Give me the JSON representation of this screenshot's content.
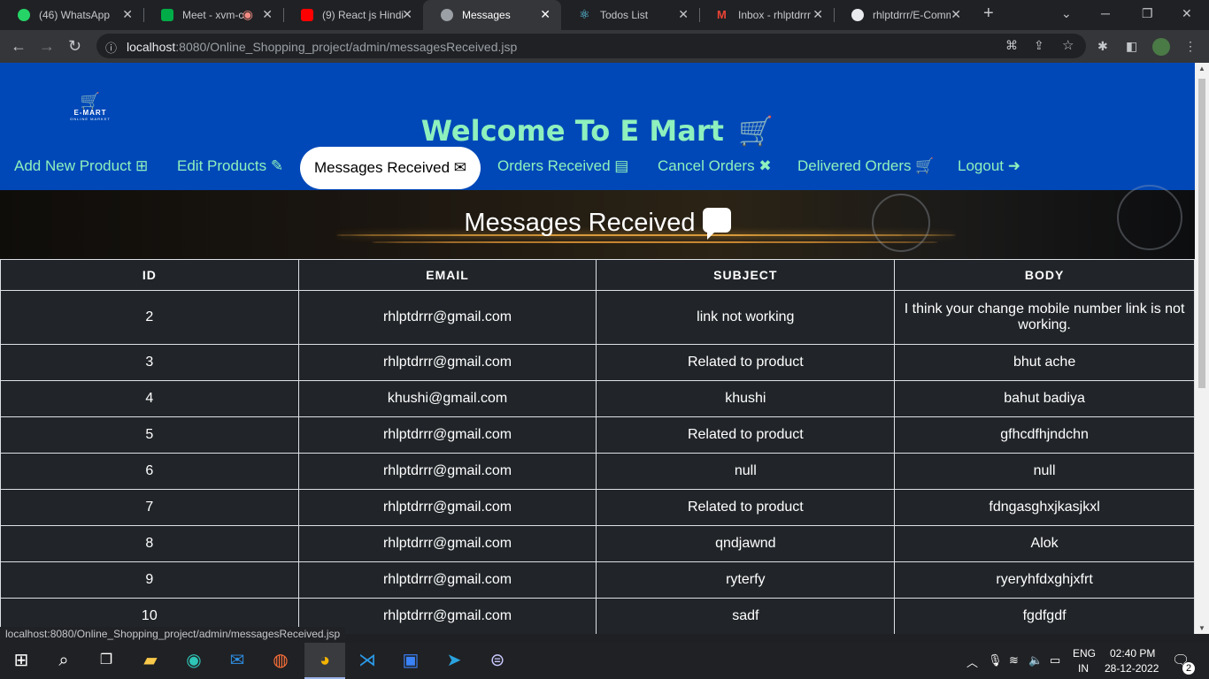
{
  "tabs": [
    {
      "title": "(46) WhatsApp",
      "color": "#25d366"
    },
    {
      "title": "Meet - xvm-c",
      "color": "#00ac47"
    },
    {
      "title": "(9) React js Hindi",
      "color": "#ff0000"
    },
    {
      "title": "Messages",
      "color": "#9aa0a6"
    },
    {
      "title": "Todos List",
      "color": "#61dafb"
    },
    {
      "title": "Inbox - rhlptdrrr",
      "color": "#ea4335"
    },
    {
      "title": "rhlptdrrr/E-Comm",
      "color": "#e8eaed"
    }
  ],
  "address": {
    "host": "localhost",
    "path": ":8080/Online_Shopping_project/admin/messagesReceived.jsp"
  },
  "header": {
    "logo_line1": "E-MART",
    "logo_line2": "ONLINE MARKET",
    "welcome": "Welcome To E Mart  🛒"
  },
  "nav": [
    "Add New Product ⊞",
    "Edit Products ✎",
    "Messages Received ✉",
    "Orders Received ▤",
    "Cancel Orders ✖",
    "Delivered Orders 🛒",
    "Logout ➜"
  ],
  "page_title": "Messages Received",
  "columns": [
    "ID",
    "EMAIL",
    "SUBJECT",
    "BODY"
  ],
  "rows": [
    {
      "id": "2",
      "email": "rhlptdrrr@gmail.com",
      "subject": "link not working",
      "body": "I think your change mobile number link is not working."
    },
    {
      "id": "3",
      "email": "rhlptdrrr@gmail.com",
      "subject": "Related to product",
      "body": "bhut ache"
    },
    {
      "id": "4",
      "email": "khushi@gmail.com",
      "subject": "khushi",
      "body": "bahut badiya"
    },
    {
      "id": "5",
      "email": "rhlptdrrr@gmail.com",
      "subject": "Related to product",
      "body": "gfhcdfhjndchn"
    },
    {
      "id": "6",
      "email": "rhlptdrrr@gmail.com",
      "subject": "null",
      "body": "null"
    },
    {
      "id": "7",
      "email": "rhlptdrrr@gmail.com",
      "subject": "Related to product",
      "body": "fdngasghxjkasjkxl"
    },
    {
      "id": "8",
      "email": "rhlptdrrr@gmail.com",
      "subject": "qndjawnd",
      "body": "Alok"
    },
    {
      "id": "9",
      "email": "rhlptdrrr@gmail.com",
      "subject": "ryterfy",
      "body": "ryeryhfdxghjxfrt"
    },
    {
      "id": "10",
      "email": "rhlptdrrr@gmail.com",
      "subject": "sadf",
      "body": "fgdfgdf"
    }
  ],
  "status_url": "localhost:8080/Online_Shopping_project/admin/messagesReceived.jsp",
  "tray": {
    "lang1": "ENG",
    "lang2": "IN",
    "time": "02:40 PM",
    "date": "28-12-2022",
    "notifications": "2"
  }
}
